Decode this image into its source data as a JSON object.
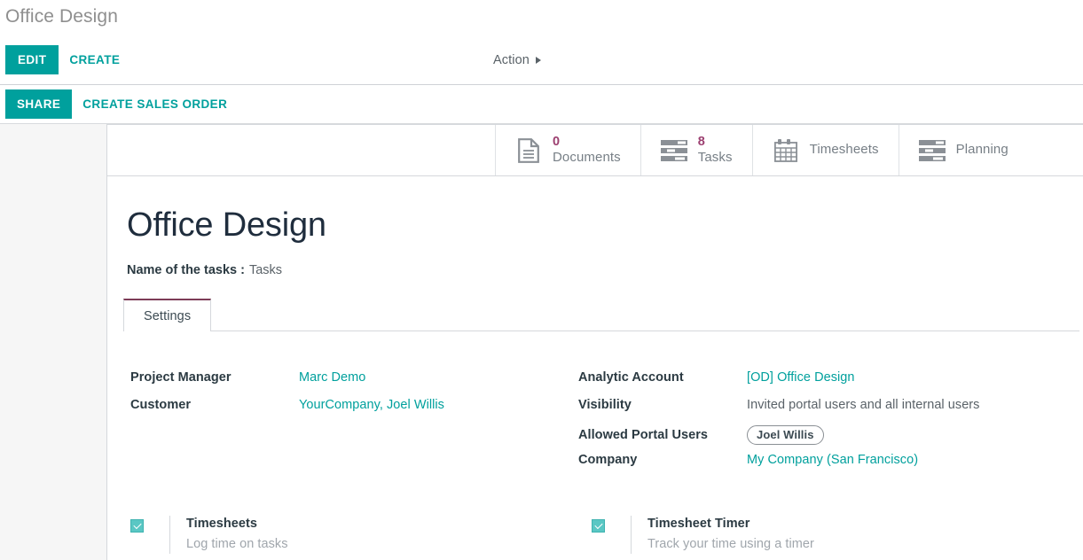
{
  "breadcrumb": {
    "title": "Office Design"
  },
  "control_panel": {
    "edit_label": "EDIT",
    "create_label": "CREATE",
    "action_label": "Action",
    "share_label": "SHARE",
    "create_sales_order_label": "CREATE SALES ORDER"
  },
  "stat_buttons": [
    {
      "value": "0",
      "label": "Documents",
      "icon": "document-icon"
    },
    {
      "value": "8",
      "label": "Tasks",
      "icon": "tasks-list-icon"
    },
    {
      "value": "",
      "label": "Timesheets",
      "icon": "calendar-icon"
    },
    {
      "value": "",
      "label": "Planning",
      "icon": "planning-bars-icon"
    }
  ],
  "record": {
    "title": "Office Design",
    "subfield_label": "Name of the tasks :",
    "subfield_value": "Tasks"
  },
  "tabs": [
    {
      "label": "Settings",
      "active": true
    }
  ],
  "form": {
    "left": [
      {
        "label": "Project Manager",
        "value": "Marc Demo",
        "is_link": true
      },
      {
        "label": "Customer",
        "value": "YourCompany, Joel Willis",
        "is_link": true
      }
    ],
    "right": [
      {
        "label": "Analytic Account",
        "value": "[OD] Office Design",
        "is_link": true
      },
      {
        "label": "Visibility",
        "value": "Invited portal users and all internal users",
        "is_link": false
      },
      {
        "label": "Allowed Portal Users",
        "value": "Joel Willis",
        "is_tag": true
      },
      {
        "label": "Company",
        "value": "My Company (San Francisco)",
        "is_link": true
      }
    ]
  },
  "settings": [
    {
      "title": "Timesheets",
      "description": "Log time on tasks",
      "checked": true
    },
    {
      "title": "Timesheet Timer",
      "description": "Track your time using a timer",
      "checked": true
    }
  ],
  "colors": {
    "accent_teal": "#00a09d",
    "stat_value_purple": "#9c3f70",
    "tab_active_border": "#7d3c57",
    "checkbox_teal": "#5ac7c4",
    "page_background": "#f6f6f6"
  }
}
